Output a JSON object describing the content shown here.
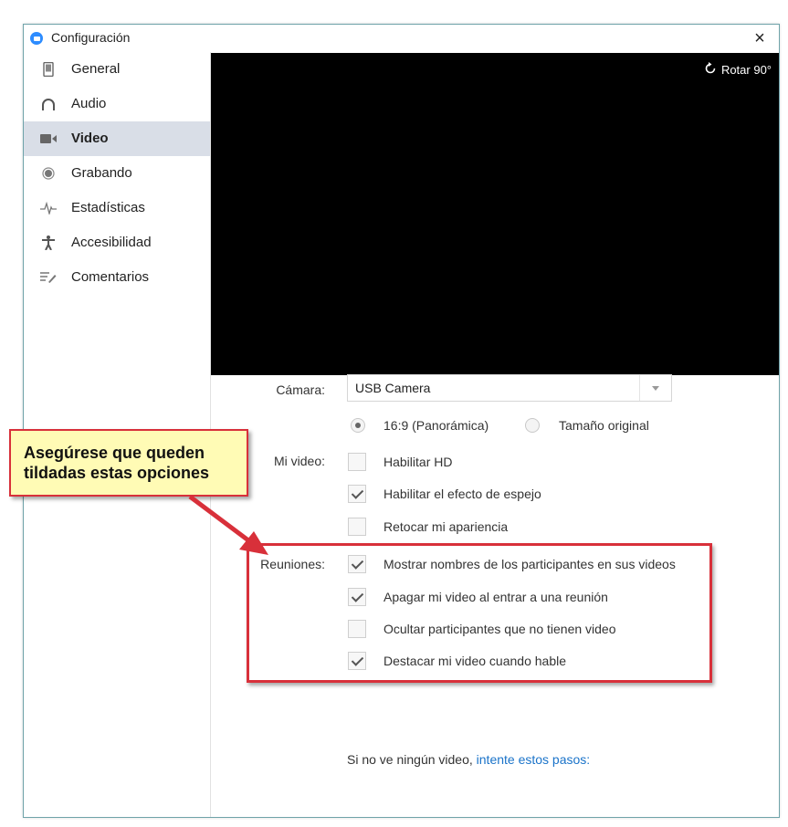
{
  "window": {
    "title": "Configuración",
    "close_label": "×"
  },
  "sidebar": {
    "items": [
      {
        "label": "General",
        "icon": "phone-icon"
      },
      {
        "label": "Audio",
        "icon": "headphones-icon"
      },
      {
        "label": "Video",
        "icon": "video-camera-icon",
        "active": true
      },
      {
        "label": "Grabando",
        "icon": "record-icon"
      },
      {
        "label": "Estadísticas",
        "icon": "pulse-icon"
      },
      {
        "label": "Accesibilidad",
        "icon": "accessibility-icon"
      },
      {
        "label": "Comentarios",
        "icon": "feedback-icon"
      }
    ]
  },
  "preview": {
    "rotate_label": "Rotar 90°"
  },
  "camera": {
    "label": "Cámara:",
    "selected": "USB Camera"
  },
  "aspect": {
    "options": [
      {
        "label": "16:9 (Panorámica)",
        "checked": true
      },
      {
        "label": "Tamaño original",
        "checked": false
      }
    ]
  },
  "my_video": {
    "label": "Mi video:",
    "options": [
      {
        "label": "Habilitar HD",
        "checked": false
      },
      {
        "label": "Habilitar el efecto de espejo",
        "checked": true
      },
      {
        "label": "Retocar mi apariencia",
        "checked": false
      }
    ]
  },
  "meetings": {
    "label": "Reuniones:",
    "options": [
      {
        "label": "Mostrar nombres de los participantes en sus videos",
        "checked": true
      },
      {
        "label": "Apagar mi video al entrar a una reunión",
        "checked": true
      },
      {
        "label": "Ocultar participantes que no tienen video",
        "checked": false
      },
      {
        "label": "Destacar mi video cuando hable",
        "checked": true
      }
    ]
  },
  "callout": {
    "line1": "Asegúrese que queden",
    "line2": "tildadas estas opciones"
  },
  "footer": {
    "text": "Si no ve ningún video,",
    "link": "intente estos pasos:"
  },
  "colors": {
    "accent": "#2d8cff",
    "annotation_red": "#d8303a",
    "callout_bg": "#fffbb5",
    "link": "#1a73c9"
  }
}
